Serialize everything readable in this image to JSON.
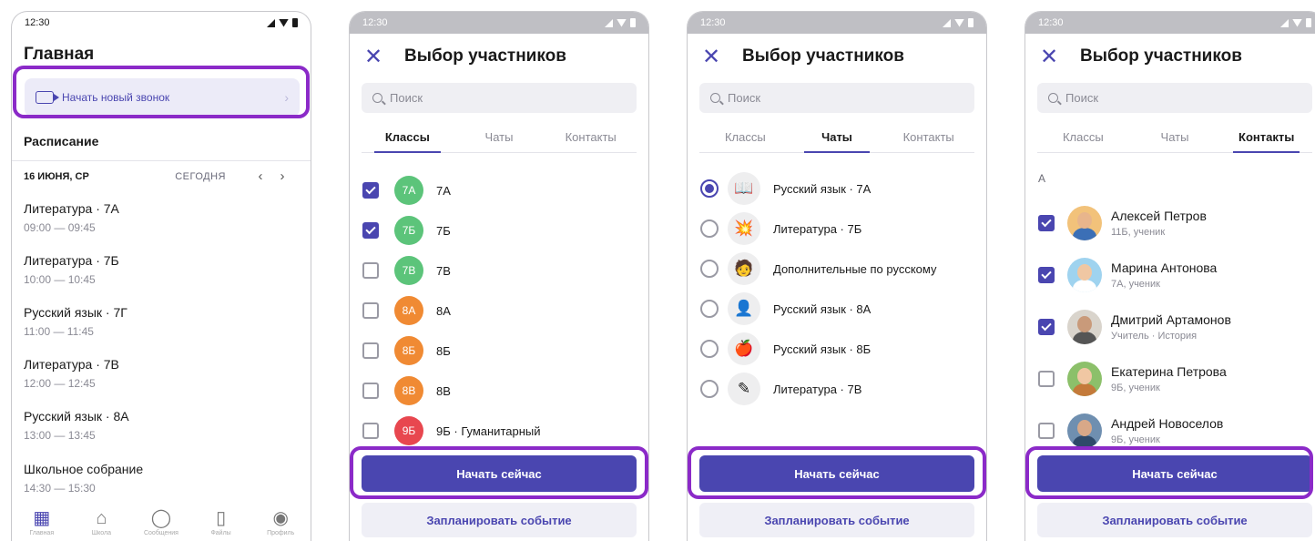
{
  "status_time": "12:30",
  "screen1": {
    "title": "Главная",
    "call_button": "Начать новый звонок",
    "schedule_label": "Расписание",
    "date": "16 ИЮНЯ, СР",
    "today": "СЕГОДНЯ",
    "lessons": [
      {
        "name": "Литература · 7А",
        "time": "09:00 — 09:45"
      },
      {
        "name": "Литература · 7Б",
        "time": "10:00 — 10:45"
      },
      {
        "name": "Русский язык · 7Г",
        "time": "11:00 — 11:45"
      },
      {
        "name": "Литература · 7В",
        "time": "12:00 — 12:45"
      },
      {
        "name": "Русский язык · 8А",
        "time": "13:00 — 13:45"
      },
      {
        "name": "Школьное собрание",
        "time": "14:30 — 15:30"
      }
    ],
    "tabbar": [
      "Главная",
      "Школа",
      "Сообщения",
      "Файлы",
      "Профиль"
    ]
  },
  "picker": {
    "title": "Выбор участников",
    "search_placeholder": "Поиск",
    "tabs": [
      "Классы",
      "Чаты",
      "Контакты"
    ],
    "primary_button": "Начать сейчас",
    "secondary_button": "Запланировать событие"
  },
  "screen2": {
    "items": [
      {
        "badge": "7А",
        "label": "7А",
        "checked": true,
        "color": "#5cc47a"
      },
      {
        "badge": "7Б",
        "label": "7Б",
        "checked": true,
        "color": "#5cc47a"
      },
      {
        "badge": "7В",
        "label": "7В",
        "checked": false,
        "color": "#5cc47a"
      },
      {
        "badge": "8А",
        "label": "8А",
        "checked": false,
        "color": "#f08a33"
      },
      {
        "badge": "8Б",
        "label": "8Б",
        "checked": false,
        "color": "#f08a33"
      },
      {
        "badge": "8В",
        "label": "8В",
        "checked": false,
        "color": "#f08a33"
      },
      {
        "badge": "9Б",
        "label": "9Б · Гуманитарный",
        "checked": false,
        "color": "#e8474f"
      }
    ]
  },
  "screen3": {
    "items": [
      {
        "icon": "book-icon",
        "glyph": "📖",
        "label": "Русский язык · 7А",
        "selected": true
      },
      {
        "icon": "burst-icon",
        "glyph": "💥",
        "label": "Литература · 7Б",
        "selected": false
      },
      {
        "icon": "astronaut-icon",
        "glyph": "🧑",
        "label": "Дополнительные по русскому",
        "selected": false
      },
      {
        "icon": "person-icon",
        "glyph": "👤",
        "label": "Русский язык · 8А",
        "selected": false
      },
      {
        "icon": "apple-icon",
        "glyph": "🍎",
        "label": "Русский язык · 8Б",
        "selected": false
      },
      {
        "icon": "pen-icon",
        "glyph": "✎",
        "label": "Литература · 7В",
        "selected": false
      }
    ]
  },
  "screen4": {
    "letter": "А",
    "contacts": [
      {
        "name": "Алексей Петров",
        "sub": "11Б, ученик",
        "checked": true,
        "bg": "#f2c27a",
        "skin": "#e8b58c",
        "cloth": "#3b6fb6"
      },
      {
        "name": "Марина Антонова",
        "sub": "7А, ученик",
        "checked": true,
        "bg": "#9fd3ef",
        "skin": "#f0c7a3",
        "cloth": "#ffffff"
      },
      {
        "name": "Дмитрий Артамонов",
        "sub": "Учитель · История",
        "checked": true,
        "bg": "#d9d4cc",
        "skin": "#c99a7a",
        "cloth": "#555555"
      },
      {
        "name": "Екатерина Петрова",
        "sub": "9Б, ученик",
        "checked": false,
        "bg": "#8cc06a",
        "skin": "#f0c7a3",
        "cloth": "#c47a3a"
      },
      {
        "name": "Андрей Новоселов",
        "sub": "9Б, ученик",
        "checked": false,
        "bg": "#6f8fb0",
        "skin": "#d8a888",
        "cloth": "#2f4a6a"
      }
    ]
  }
}
